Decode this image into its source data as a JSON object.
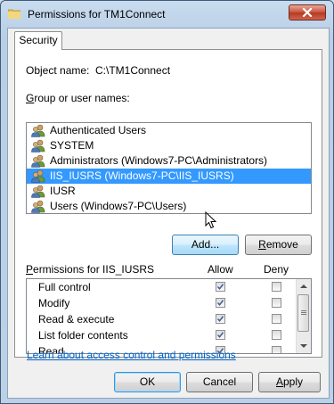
{
  "window": {
    "title": "Permissions for TM1Connect",
    "icon": "folder-icon"
  },
  "tabs": [
    {
      "label": "Security"
    }
  ],
  "object": {
    "label": "Object name:",
    "value": "C:\\TM1Connect"
  },
  "groups": {
    "label": "Group or user names:",
    "items": [
      {
        "label": "Authenticated Users",
        "icon": "users-group-icon"
      },
      {
        "label": "SYSTEM",
        "icon": "users-group-icon"
      },
      {
        "label": "Administrators (Windows7-PC\\Administrators)",
        "icon": "users-group-icon"
      },
      {
        "label": "IIS_IUSRS (Windows7-PC\\IIS_IUSRS)",
        "icon": "users-group-icon",
        "selected": true
      },
      {
        "label": "IUSR",
        "icon": "users-group-icon"
      },
      {
        "label": "Users (Windows7-PC\\Users)",
        "icon": "users-group-icon"
      }
    ]
  },
  "buttons": {
    "add": "Add...",
    "remove": "Remove",
    "ok": "OK",
    "cancel": "Cancel",
    "apply": "Apply"
  },
  "permissions": {
    "label": "Permissions for IIS_IUSRS",
    "allow_header": "Allow",
    "deny_header": "Deny",
    "rows": [
      {
        "name": "Full control",
        "allow": true,
        "deny": false
      },
      {
        "name": "Modify",
        "allow": true,
        "deny": false
      },
      {
        "name": "Read & execute",
        "allow": true,
        "deny": false
      },
      {
        "name": "List folder contents",
        "allow": true,
        "deny": false
      },
      {
        "name": "Read",
        "allow": true,
        "deny": false
      }
    ]
  },
  "help_link": "Learn about access control and permissions",
  "colors": {
    "selection": "#3399ff",
    "link": "#0066cc",
    "close_button": "#c7513a"
  }
}
